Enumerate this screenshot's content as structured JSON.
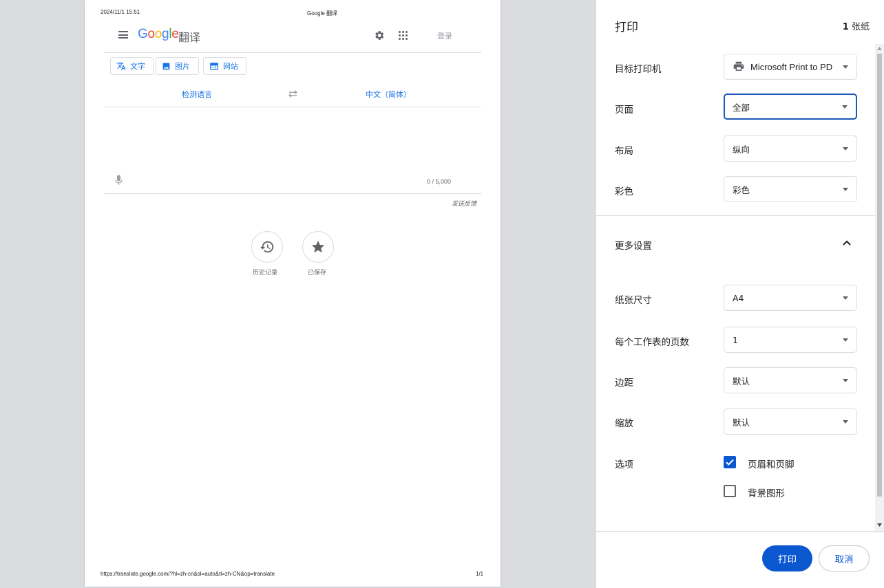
{
  "preview": {
    "header_date": "2024/11/1 15:51",
    "header_title": "Google 翻译",
    "app_title": "翻译",
    "google_letters": [
      "G",
      "o",
      "o",
      "g",
      "l",
      "e"
    ],
    "sign_in": "登录",
    "chips": [
      {
        "label": "文字",
        "icon": "translate-icon"
      },
      {
        "label": "图片",
        "icon": "image-icon"
      },
      {
        "label": "网站",
        "icon": "website-icon"
      }
    ],
    "source_lang": "检测语言",
    "target_lang": "中文（简体）",
    "char_count": "0 / 5,000",
    "feedback": "发送反馈",
    "history_label": "历史记录",
    "saved_label": "已保存",
    "footer_url": "https://translate.google.com/?hl=zh-cn&sl=auto&tl=zh-CN&op=translate",
    "footer_page": "1/1"
  },
  "panel": {
    "title": "打印",
    "sheet_count": "1",
    "sheet_unit": "张纸",
    "rows": {
      "destination": {
        "label": "目标打印机",
        "value": "Microsoft Print to PD"
      },
      "pages": {
        "label": "页面",
        "value": "全部"
      },
      "layout": {
        "label": "布局",
        "value": "纵向"
      },
      "color": {
        "label": "彩色",
        "value": "彩色"
      }
    },
    "more_settings": "更多设置",
    "more_rows": {
      "paper_size": {
        "label": "纸张尺寸",
        "value": "A4"
      },
      "pages_per_sheet": {
        "label": "每个工作表的页数",
        "value": "1"
      },
      "margins": {
        "label": "边距",
        "value": "默认"
      },
      "scale": {
        "label": "缩放",
        "value": "默认"
      }
    },
    "options_label": "选项",
    "options": [
      {
        "label": "页眉和页脚",
        "checked": true
      },
      {
        "label": "背景图形",
        "checked": false
      }
    ],
    "print_button": "打印",
    "cancel_button": "取消"
  },
  "colors": {
    "accent": "#0b57d0",
    "link_blue": "#1a73e8",
    "google_blue": "#4285f4",
    "google_red": "#ea4335",
    "google_yellow": "#fbbc05",
    "google_green": "#34a853"
  }
}
